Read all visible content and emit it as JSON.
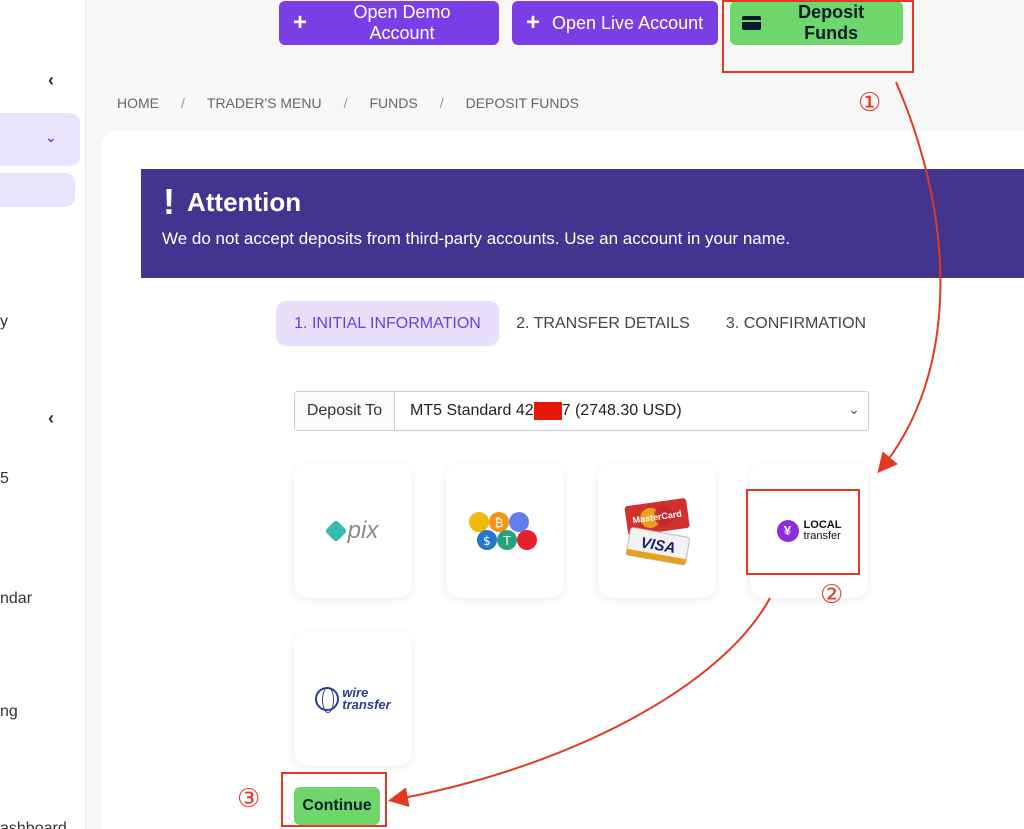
{
  "sidebar": {
    "partial_labels": [
      "y",
      "5",
      "ndar",
      "ng",
      "ashboard"
    ]
  },
  "top_buttons": {
    "demo": "Open Demo Account",
    "live": "Open Live Account",
    "deposit": "Deposit Funds"
  },
  "breadcrumb": [
    "HOME",
    "TRADER'S MENU",
    "FUNDS",
    "DEPOSIT FUNDS"
  ],
  "breadcrumb_separator": "/",
  "alert": {
    "title": "Attention",
    "message": "We do not accept deposits from third-party accounts. Use an account in your name."
  },
  "steps": [
    "1. INITIAL INFORMATION",
    "2. TRANSFER DETAILS",
    "3. CONFIRMATION"
  ],
  "deposit_to": {
    "label": "Deposit To",
    "value_prefix": "MT5 Standard 42",
    "value_suffix": "7 (2748.30 USD)"
  },
  "methods": {
    "pix": "pix",
    "local": {
      "line1": "LOCAL",
      "line2": "transfer",
      "symbol": "¥"
    },
    "wire": {
      "line1": "wire",
      "line2": "transfer"
    },
    "card": {
      "mastercard": "MasterCard",
      "visa": "VISA"
    }
  },
  "continue_label": "Continue",
  "annotations": [
    "①",
    "②",
    "③"
  ],
  "colors": {
    "accent_purple": "#7a3fe4",
    "deposit_green": "#6ed66b",
    "alert_bg": "#443490",
    "annotation_red": "#e23a22"
  }
}
